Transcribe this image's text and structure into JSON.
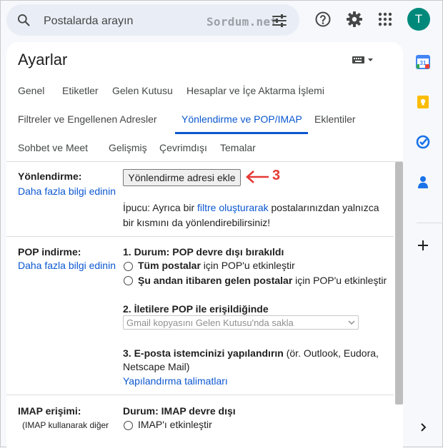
{
  "search": {
    "placeholder": "Postalarda arayın",
    "watermark": "Sordum.net"
  },
  "header": {
    "avatar_letter": "T"
  },
  "settings": {
    "title": "Ayarlar",
    "tabs_row1": [
      "Genel",
      "Etiketler",
      "Gelen Kutusu",
      "Hesaplar ve İçe Aktarma İşlemi"
    ],
    "tabs_row2": [
      "Filtreler ve Engellenen Adresler",
      "Yönlendirme ve POP/IMAP",
      "Eklentiler"
    ],
    "tabs_row3": [
      "Sohbet ve Meet",
      "Gelişmiş",
      "Çevrimdışı",
      "Temalar"
    ],
    "active_tab": "Yönlendirme ve POP/IMAP"
  },
  "forwarding": {
    "label": "Yönlendirme:",
    "learn_more": "Daha fazla bilgi edinin",
    "button": "Yönlendirme adresi ekle",
    "annotation": "3",
    "tip_prefix": "İpucu: Ayrıca bir ",
    "tip_link": "filtre oluşturarak",
    "tip_suffix": " postalarınızdan yalnızca",
    "tip_line2": "bir kısmını da yönlendirebilirsiniz!"
  },
  "pop": {
    "label": "POP indirme:",
    "learn_more": "Daha fazla bilgi edinin",
    "status": "1. Durum: POP devre dışı bırakıldı",
    "opt1_bold": "Tüm postalar",
    "opt1_rest": " için POP'u etkinleştir",
    "opt2_bold": "Şu andan itibaren gelen postalar",
    "opt2_rest": " için POP'u etkinleştir",
    "step2": "2. İletilere POP ile erişildiğinde",
    "select_value": "Gmail kopyasını Gelen Kutusu'nda sakla",
    "step3_bold": "3. E-posta istemcinizi yapılandırın",
    "step3_rest": " (ör. Outlook, Eudora,",
    "step3_line2": "Netscape Mail)",
    "config_link": "Yapılandırma talimatları"
  },
  "imap": {
    "label": "IMAP erişimi:",
    "sublabel": "(IMAP kullanarak diğer",
    "status": "Durum: IMAP devre dışı",
    "enable": "IMAP'ı etkinleştir"
  },
  "colors": {
    "accent": "#0b57d0",
    "annotation": "#e53935"
  }
}
